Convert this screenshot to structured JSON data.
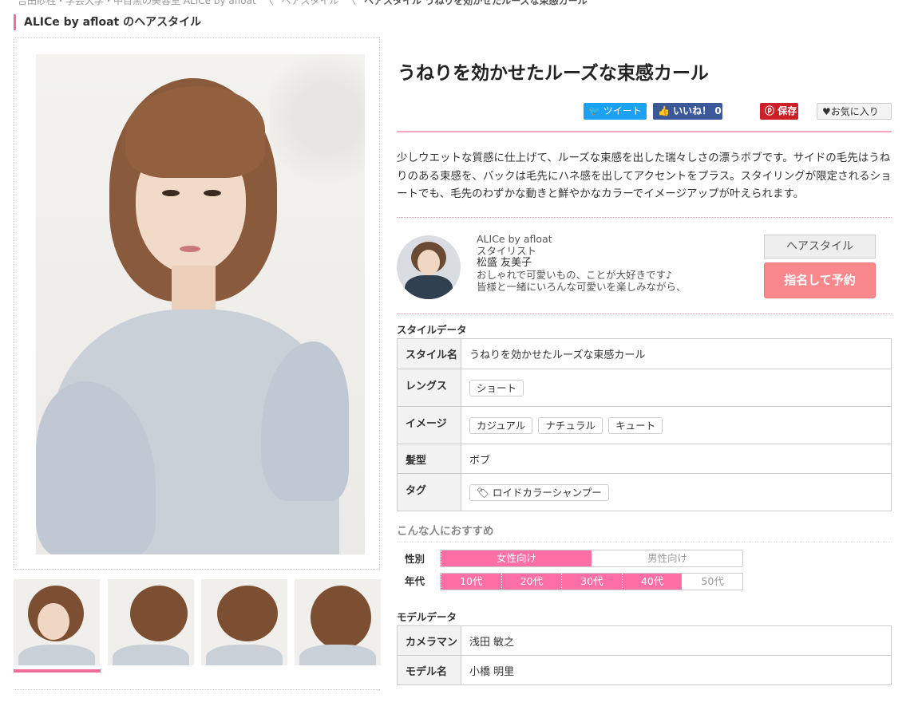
{
  "breadcrumb": [
    "吉田紗柱・学芸大学・中目黒の美容室 ALICe by afloat",
    "ヘアスタイル",
    "ヘアスタイル うねりを効かせたルーズな束感カール"
  ],
  "salon_heading": "ALICe by afloat のヘアスタイル",
  "title": "うねりを効かせたルーズな束感カール",
  "share": {
    "tweet": "ツイート",
    "like": "いいね！ 0",
    "pin": "保存",
    "fav": "♥お気に入り"
  },
  "description": "少しウエットな質感に仕上げて、ルーズな束感を出した瑞々しさの漂うボブです。サイドの毛先はうねりのある束感を、バックは毛先にハネ感を出してアクセントをプラス。スタイリングが限定されるショートでも、毛先のわずかな動きと鮮やかなカラーでイメージアップが叶えられます。",
  "stylist": {
    "salon": "ALICe by afloat",
    "role": "スタイリスト",
    "name": "松盛 友美子",
    "bio1": "おしゃれで可愛いもの、ことが大好きです♪",
    "bio2": "皆様と一緒にいろんな可愛いを楽しみながら、",
    "btn_style": "ヘアスタイル",
    "btn_book": "指名して予約"
  },
  "style_data": {
    "label": "スタイルデータ",
    "rows": {
      "style_name": {
        "k": "スタイル名",
        "v": "うねりを効かせたルーズな束感カール"
      },
      "length": {
        "k": "レングス",
        "chips": [
          "ショート"
        ]
      },
      "image": {
        "k": "イメージ",
        "chips": [
          "カジュアル",
          "ナチュラル",
          "キュート"
        ]
      },
      "hairtype": {
        "k": "髪型",
        "v": "ボブ"
      },
      "tag": {
        "k": "タグ",
        "chips": [
          "ロイドカラーシャンプー"
        ]
      }
    }
  },
  "recommend": {
    "label": "こんな人におすすめ",
    "gender_label": "性別",
    "gender": [
      {
        "t": "女性向け",
        "on": true
      },
      {
        "t": "男性向け",
        "on": false
      }
    ],
    "age_label": "年代",
    "ages": [
      {
        "t": "10代",
        "on": true
      },
      {
        "t": "20代",
        "on": true
      },
      {
        "t": "30代",
        "on": true
      },
      {
        "t": "40代",
        "on": true
      },
      {
        "t": "50代",
        "on": false
      }
    ]
  },
  "model_data": {
    "label": "モデルデータ",
    "camera": {
      "k": "カメラマン",
      "v": "浅田 敏之"
    },
    "model": {
      "k": "モデル名",
      "v": "小橋 明里"
    }
  },
  "colors": {
    "accent": "#f06e9a",
    "book": "#f8888c",
    "bar_on": "#ff6fa5"
  }
}
